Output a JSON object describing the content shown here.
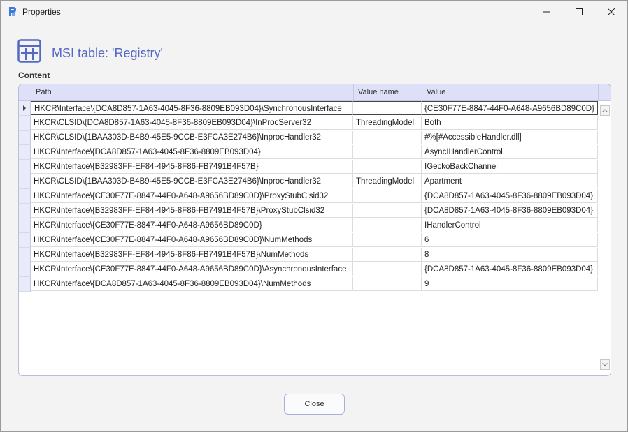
{
  "window": {
    "title": "Properties"
  },
  "header": {
    "title": "MSI table: 'Registry'"
  },
  "content": {
    "label": "Content"
  },
  "grid": {
    "columns": [
      "Path",
      "Value name",
      "Value"
    ],
    "rows": [
      {
        "path": "HKCR\\Interface\\{DCA8D857-1A63-4045-8F36-8809EB093D04}\\SynchronousInterface",
        "name": "",
        "value": "{CE30F77E-8847-44F0-A648-A9656BD89C0D}"
      },
      {
        "path": "HKCR\\CLSID\\{DCA8D857-1A63-4045-8F36-8809EB093D04}\\InProcServer32",
        "name": "ThreadingModel",
        "value": "Both"
      },
      {
        "path": "HKCR\\CLSID\\{1BAA303D-B4B9-45E5-9CCB-E3FCA3E274B6}\\InprocHandler32",
        "name": "",
        "value": "#%[#AccessibleHandler.dll]"
      },
      {
        "path": "HKCR\\Interface\\{DCA8D857-1A63-4045-8F36-8809EB093D04}",
        "name": "",
        "value": "AsyncIHandlerControl"
      },
      {
        "path": "HKCR\\Interface\\{B32983FF-EF84-4945-8F86-FB7491B4F57B}",
        "name": "",
        "value": "IGeckoBackChannel"
      },
      {
        "path": "HKCR\\CLSID\\{1BAA303D-B4B9-45E5-9CCB-E3FCA3E274B6}\\InprocHandler32",
        "name": "ThreadingModel",
        "value": "Apartment"
      },
      {
        "path": "HKCR\\Interface\\{CE30F77E-8847-44F0-A648-A9656BD89C0D}\\ProxyStubClsid32",
        "name": "",
        "value": "{DCA8D857-1A63-4045-8F36-8809EB093D04}"
      },
      {
        "path": "HKCR\\Interface\\{B32983FF-EF84-4945-8F86-FB7491B4F57B}\\ProxyStubClsid32",
        "name": "",
        "value": "{DCA8D857-1A63-4045-8F36-8809EB093D04}"
      },
      {
        "path": "HKCR\\Interface\\{CE30F77E-8847-44F0-A648-A9656BD89C0D}",
        "name": "",
        "value": "IHandlerControl"
      },
      {
        "path": "HKCR\\Interface\\{CE30F77E-8847-44F0-A648-A9656BD89C0D}\\NumMethods",
        "name": "",
        "value": "6"
      },
      {
        "path": "HKCR\\Interface\\{B32983FF-EF84-4945-8F86-FB7491B4F57B}\\NumMethods",
        "name": "",
        "value": "8"
      },
      {
        "path": "HKCR\\Interface\\{CE30F77E-8847-44F0-A648-A9656BD89C0D}\\AsynchronousInterface",
        "name": "",
        "value": "{DCA8D857-1A63-4045-8F36-8809EB093D04}"
      },
      {
        "path": "HKCR\\Interface\\{DCA8D857-1A63-4045-8F36-8809EB093D04}\\NumMethods",
        "name": "",
        "value": "9"
      }
    ]
  },
  "footer": {
    "close_label": "Close"
  },
  "icons": {
    "app": "app-logo-icon",
    "table": "table-icon",
    "minimize": "minimize-icon",
    "maximize": "maximize-icon",
    "close": "close-icon",
    "scroll_up": "chevron-up-icon",
    "scroll_down": "chevron-down-icon"
  },
  "colors": {
    "accent": "#5468c6",
    "header_bg": "#dde0f7"
  }
}
